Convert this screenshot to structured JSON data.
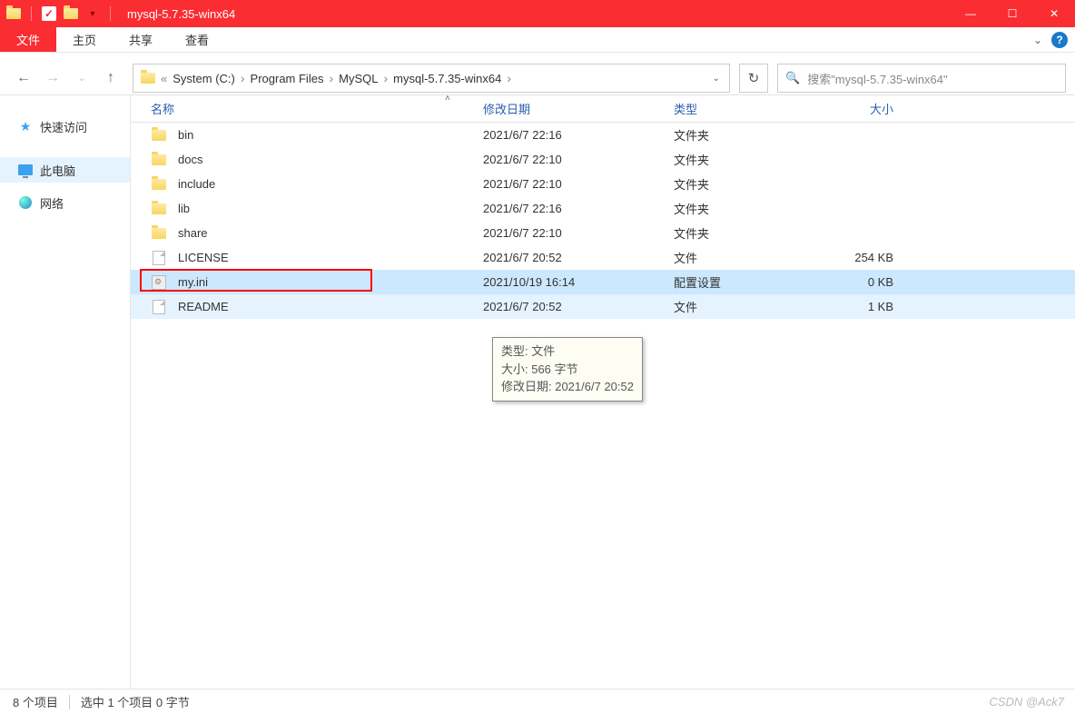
{
  "titlebar": {
    "title": "mysql-5.7.35-winx64"
  },
  "ribbon": {
    "tabs": {
      "file": "文件",
      "home": "主页",
      "share": "共享",
      "view": "查看"
    }
  },
  "breadcrumbs": {
    "lead": "«",
    "items": [
      "System (C:)",
      "Program Files",
      "MySQL",
      "mysql-5.7.35-winx64"
    ]
  },
  "search": {
    "placeholder": "搜索\"mysql-5.7.35-winx64\""
  },
  "sidebar": {
    "quick": "快速访问",
    "pc": "此电脑",
    "network": "网络"
  },
  "columns": {
    "name": "名称",
    "date": "修改日期",
    "type": "类型",
    "size": "大小"
  },
  "files": [
    {
      "name": "bin",
      "date": "2021/6/7 22:16",
      "type": "文件夹",
      "size": "",
      "icon": "folder"
    },
    {
      "name": "docs",
      "date": "2021/6/7 22:10",
      "type": "文件夹",
      "size": "",
      "icon": "folder"
    },
    {
      "name": "include",
      "date": "2021/6/7 22:10",
      "type": "文件夹",
      "size": "",
      "icon": "folder"
    },
    {
      "name": "lib",
      "date": "2021/6/7 22:16",
      "type": "文件夹",
      "size": "",
      "icon": "folder"
    },
    {
      "name": "share",
      "date": "2021/6/7 22:10",
      "type": "文件夹",
      "size": "",
      "icon": "folder"
    },
    {
      "name": "LICENSE",
      "date": "2021/6/7 20:52",
      "type": "文件",
      "size": "254 KB",
      "icon": "file"
    },
    {
      "name": "my.ini",
      "date": "2021/10/19 16:14",
      "type": "配置设置",
      "size": "0 KB",
      "icon": "ini",
      "selected": true,
      "highlighted": true
    },
    {
      "name": "README",
      "date": "2021/6/7 20:52",
      "type": "文件",
      "size": "1 KB",
      "icon": "file",
      "hover": true
    }
  ],
  "tooltip": {
    "line1": "类型: 文件",
    "line2": "大小: 566 字节",
    "line3": "修改日期: 2021/6/7 20:52"
  },
  "statusbar": {
    "count": "8 个项目",
    "selection": "选中 1 个项目 0 字节"
  },
  "watermark": "CSDN @Ack7"
}
